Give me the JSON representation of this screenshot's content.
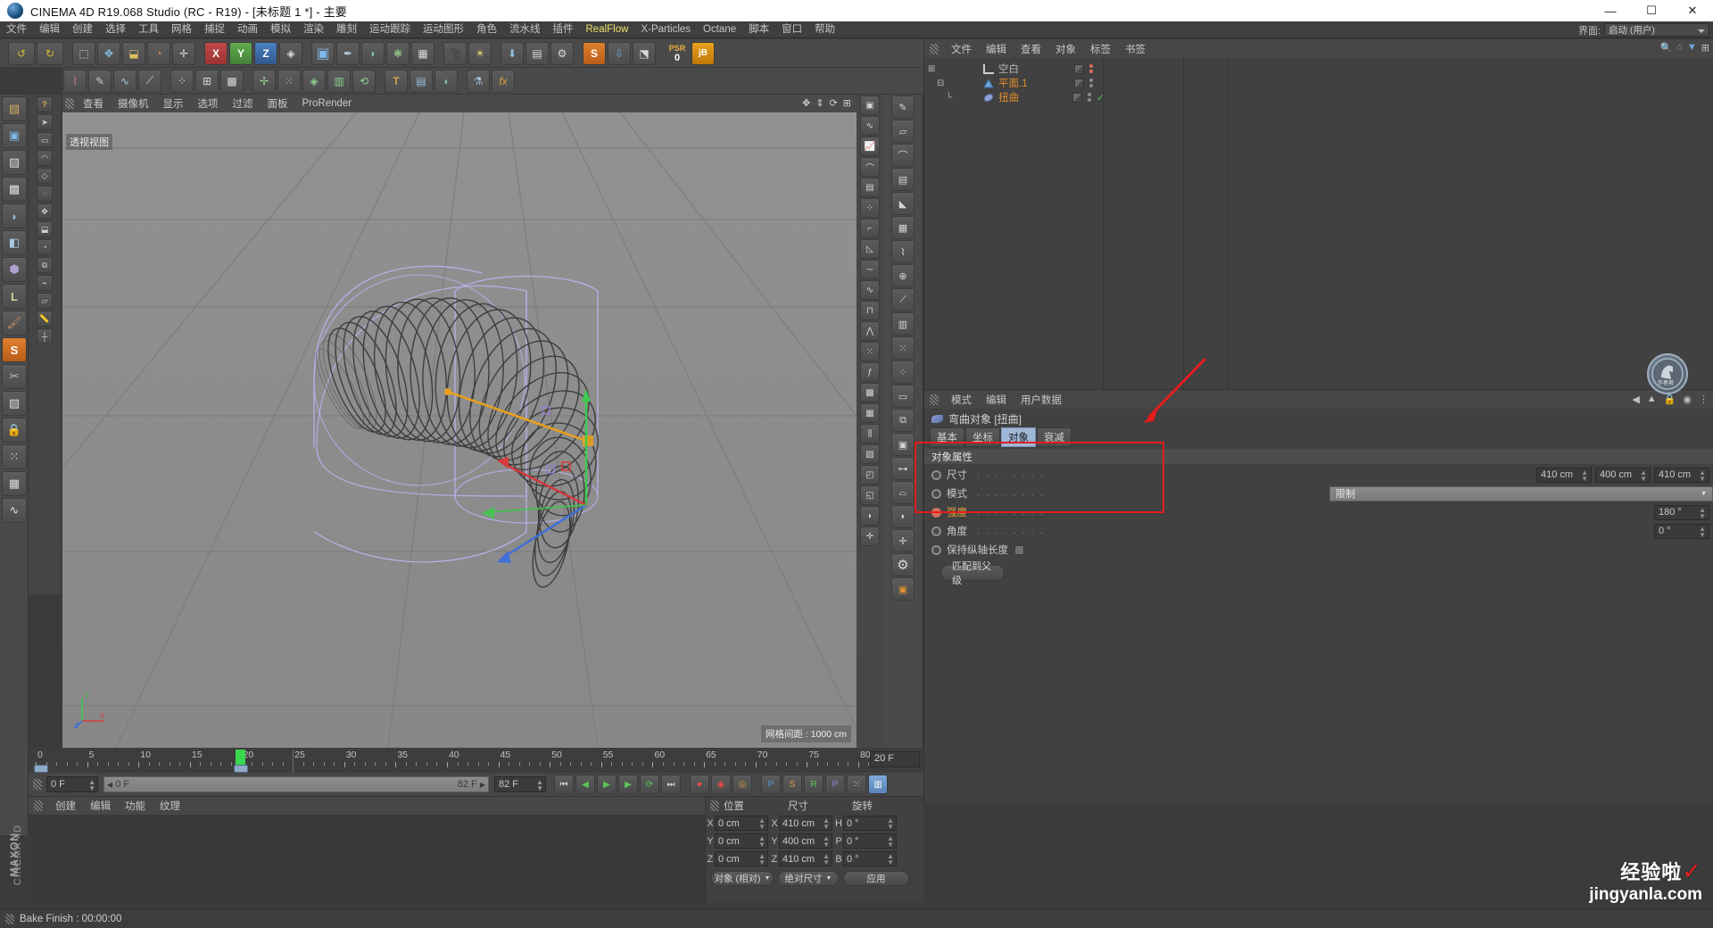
{
  "window": {
    "title": "CINEMA 4D R19.068 Studio (RC - R19) - [未标题 1 *] - 主要",
    "minimize": "—",
    "maximize": "☐",
    "close": "✕",
    "logo_icon": "c4d-logo-icon"
  },
  "menubar": {
    "items": [
      {
        "label": "文件"
      },
      {
        "label": "编辑"
      },
      {
        "label": "创建"
      },
      {
        "label": "选择"
      },
      {
        "label": "工具"
      },
      {
        "label": "网格"
      },
      {
        "label": "捕捉"
      },
      {
        "label": "动画"
      },
      {
        "label": "模拟"
      },
      {
        "label": "渲染"
      },
      {
        "label": "雕刻"
      },
      {
        "label": "运动跟踪"
      },
      {
        "label": "运动图形"
      },
      {
        "label": "角色"
      },
      {
        "label": "流水线"
      },
      {
        "label": "插件"
      },
      {
        "label": "RealFlow",
        "highlight": true
      },
      {
        "label": "X-Particles"
      },
      {
        "label": "Octane"
      },
      {
        "label": "脚本"
      },
      {
        "label": "窗口"
      },
      {
        "label": "帮助"
      }
    ],
    "interface_label": "界面:",
    "interface_value": "启动 (用户)"
  },
  "viewport": {
    "tabs": [
      {
        "label": "查看"
      },
      {
        "label": "摄像机"
      },
      {
        "label": "显示"
      },
      {
        "label": "选项"
      },
      {
        "label": "过滤"
      },
      {
        "label": "面板"
      },
      {
        "label": "ProRender"
      }
    ],
    "view_label": "透视视图",
    "grid_note": "网格间距 : 1000 cm",
    "axis_x": "X",
    "axis_y": "Y",
    "axis_z": "Z"
  },
  "object_manager": {
    "menu": [
      {
        "label": "文件"
      },
      {
        "label": "编辑"
      },
      {
        "label": "查看"
      },
      {
        "label": "对象"
      },
      {
        "label": "标签"
      },
      {
        "label": "书签"
      }
    ],
    "rows": [
      {
        "name": "空白",
        "color": "#b8b8b8",
        "icon": "null-object-icon",
        "dot_color": "#e06c5a",
        "checked": false
      },
      {
        "name": "平面.1",
        "color": "#e08a2e",
        "icon": "plane-object-icon",
        "dot_color": "#8a8a8a",
        "checked": false
      },
      {
        "name": "扭曲",
        "color": "#e08a2e",
        "icon": "twist-deformer-icon",
        "dot_color": "#8a8a8a",
        "checked": true
      }
    ]
  },
  "attribute_manager": {
    "menu": [
      {
        "label": "模式"
      },
      {
        "label": "编辑"
      },
      {
        "label": "用户数据"
      }
    ],
    "object_title": "弯曲对象 [扭曲]",
    "object_icon": "twist-deformer-icon",
    "tabs": [
      {
        "label": "基本",
        "active": false
      },
      {
        "label": "坐标",
        "active": false
      },
      {
        "label": "对象",
        "active": true
      },
      {
        "label": "衰减",
        "active": false
      }
    ],
    "section_title": "对象属性",
    "properties": [
      {
        "label": "尺寸",
        "type": "vec3",
        "values": [
          "410 cm",
          "400 cm",
          "410 cm"
        ],
        "active": false
      },
      {
        "label": "模式",
        "type": "dropdown",
        "value": "限制",
        "active": false
      },
      {
        "label": "强度",
        "type": "number",
        "value": "180 °",
        "active": true
      },
      {
        "label": "角度",
        "type": "number",
        "value": "0 °",
        "active": false
      },
      {
        "label": "保持纵轴长度",
        "type": "checkbox",
        "value": "",
        "active": false
      }
    ],
    "match_parent_button": "匹配到父级",
    "highlight_color": "#e41d1d"
  },
  "timeline": {
    "ticks": [
      {
        "value": "0",
        "pos": 0
      },
      {
        "value": "5",
        "pos": 5
      },
      {
        "value": "10",
        "pos": 10
      },
      {
        "value": "15",
        "pos": 15
      },
      {
        "value": "20",
        "pos": 20
      },
      {
        "value": "25",
        "pos": 25
      },
      {
        "value": "30",
        "pos": 30
      },
      {
        "value": "35",
        "pos": 35
      },
      {
        "value": "40",
        "pos": 40
      },
      {
        "value": "45",
        "pos": 45
      },
      {
        "value": "50",
        "pos": 50
      },
      {
        "value": "55",
        "pos": 55
      },
      {
        "value": "60",
        "pos": 60
      },
      {
        "value": "65",
        "pos": 65
      },
      {
        "value": "70",
        "pos": 70
      },
      {
        "value": "75",
        "pos": 75
      },
      {
        "value": "80",
        "pos": 80
      }
    ],
    "end_field": "20 F",
    "current_frame": "0 F",
    "range_start": "0 F",
    "range_end": "82 F",
    "max_frame": "82 F",
    "playhead_frame": 20,
    "marker_color": "#39d84f"
  },
  "material_manager": {
    "menu": [
      {
        "label": "创建"
      },
      {
        "label": "编辑"
      },
      {
        "label": "功能"
      },
      {
        "label": "纹理"
      }
    ]
  },
  "coordinates": {
    "headers": [
      "位置",
      "尺寸",
      "旋转"
    ],
    "rows": [
      {
        "l1": "X",
        "v1": "0 cm",
        "l2": "X",
        "v2": "410 cm",
        "l3": "H",
        "v3": "0 °"
      },
      {
        "l1": "Y",
        "v1": "0 cm",
        "l2": "Y",
        "v2": "400 cm",
        "l3": "P",
        "v3": "0 °"
      },
      {
        "l1": "Z",
        "v1": "0 cm",
        "l2": "Z",
        "v2": "410 cm",
        "l3": "B",
        "v3": "0 °"
      }
    ],
    "mode_dropdown": "对象 (相对)",
    "size_dropdown": "绝对尺寸",
    "apply_button": "应用"
  },
  "status": {
    "text": "Bake Finish : 00:00:00"
  },
  "brand": {
    "line1": "MAXON",
    "line2": "CINEMA 4D"
  },
  "watermark": {
    "line1": "经验啦",
    "check": "✓",
    "line2": "jingyanla.com"
  },
  "toolbar": {
    "psr_label": "PSR",
    "psr_value": "0",
    "undo_icon": "undo-icon",
    "redo_icon": "redo-icon",
    "select_icon": "select-icon",
    "move_icon": "move-icon",
    "scale_icon": "scale-icon",
    "rotate-icon": "rotate-icon",
    "axis_x": "X",
    "axis_y": "Y",
    "axis_z": "Z",
    "cube_icon": "cube-primitive-icon",
    "spline_icon": "spline-icon",
    "nurbs_icon": "nurbs-icon",
    "array_icon": "array-icon",
    "deformer_icon": "deformer-icon",
    "camera_icon": "camera-icon",
    "light_icon": "light-icon",
    "render_icon": "render-icon",
    "render_region_icon": "render-region-icon",
    "render_settings_icon": "render-settings-icon",
    "text_icon": "text-tool-icon",
    "mograph_icon": "mograph-icon",
    "s_icon": "sculpt-icon",
    "jb_icon": "jb-plugin-icon"
  }
}
